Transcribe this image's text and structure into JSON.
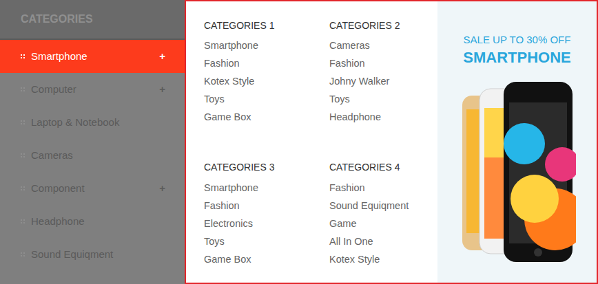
{
  "sidebar": {
    "title": "CATEGORIES",
    "items": [
      {
        "label": "Smartphone",
        "expandable": true,
        "selected": true,
        "expand_icon": "+"
      },
      {
        "label": "Computer",
        "expandable": true,
        "selected": false,
        "expand_icon": "+"
      },
      {
        "label": "Laptop & Notebook",
        "expandable": false,
        "selected": false,
        "expand_icon": ""
      },
      {
        "label": "Cameras",
        "expandable": false,
        "selected": false,
        "expand_icon": ""
      },
      {
        "label": "Component",
        "expandable": true,
        "selected": false,
        "expand_icon": "+"
      },
      {
        "label": "Headphone",
        "expandable": false,
        "selected": false,
        "expand_icon": ""
      },
      {
        "label": "Sound Equiqment",
        "expandable": false,
        "selected": false,
        "expand_icon": ""
      }
    ]
  },
  "menu": {
    "groups": [
      {
        "title": "CATEGORIES 1",
        "links": [
          "Smartphone",
          "Fashion",
          "Kotex Style",
          "Toys",
          "Game Box"
        ]
      },
      {
        "title": "CATEGORIES 2",
        "links": [
          "Cameras",
          "Fashion",
          "Johny Walker",
          "Toys",
          "Headphone"
        ]
      },
      {
        "title": "CATEGORIES 3",
        "links": [
          "Smartphone",
          "Fashion",
          "Electronics",
          "Toys",
          "Game Box"
        ]
      },
      {
        "title": "CATEGORIES 4",
        "links": [
          "Fashion",
          "Sound Equiqment",
          "Game",
          "All In One",
          "Kotex Style"
        ]
      }
    ]
  },
  "promo": {
    "headline": "SALE UP TO 30% OFF",
    "product": "SMARTPHONE"
  }
}
